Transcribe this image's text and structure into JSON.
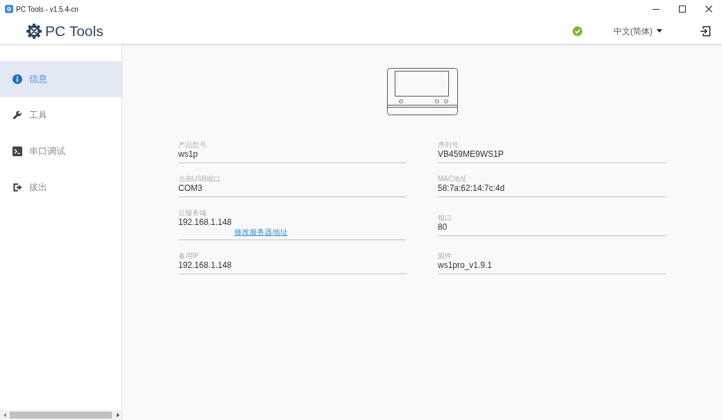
{
  "window": {
    "title": "PC Tools - v1.5.4-cn"
  },
  "header": {
    "logo": "PC Tools",
    "connected": true,
    "language": "中文(简体)"
  },
  "sidebar": {
    "items": [
      {
        "label": "信息",
        "selected": true
      },
      {
        "label": "工具",
        "selected": false
      },
      {
        "label": "串口调试",
        "selected": false
      },
      {
        "label": "拔出",
        "selected": false
      }
    ]
  },
  "device_info": {
    "fields": [
      {
        "label": "产品型号",
        "value": "ws1p"
      },
      {
        "label": "序列号",
        "value": "VB459ME9WS1P"
      },
      {
        "label": "当前USB端口",
        "value": "COM3"
      },
      {
        "label": "MAC地址",
        "value": "58:7a:62:14:7c:4d"
      },
      {
        "label": "云服务端",
        "value": "192.168.1.148",
        "link": "修改服务器地址"
      },
      {
        "label": "端口",
        "value": "80"
      },
      {
        "label": "备用IP",
        "value": "192.168.1.148"
      },
      {
        "label": "固件",
        "value": "ws1pro_v1.9.1"
      }
    ]
  }
}
